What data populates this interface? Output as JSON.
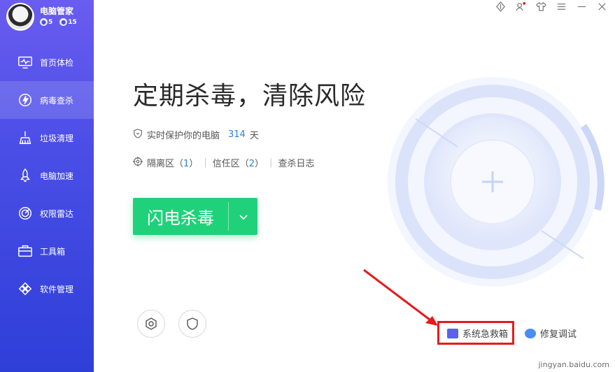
{
  "app": {
    "name": "电脑管家",
    "badges": [
      "5",
      "15"
    ]
  },
  "sidebar": {
    "items": [
      {
        "label": "首页体检",
        "icon": "monitor-pulse-icon"
      },
      {
        "label": "病毒查杀",
        "icon": "lightning-shield-icon",
        "active": true
      },
      {
        "label": "垃圾清理",
        "icon": "broom-icon"
      },
      {
        "label": "电脑加速",
        "icon": "rocket-icon"
      },
      {
        "label": "权限雷达",
        "icon": "radar-icon"
      },
      {
        "label": "工具箱",
        "icon": "toolbox-icon"
      },
      {
        "label": "软件管理",
        "icon": "apps-icon"
      }
    ]
  },
  "main": {
    "headline": "定期杀毒，清除风险",
    "protect_text": "实时保护你的电脑",
    "protect_days": "314",
    "protect_unit": "天",
    "quarantine_label": "隔离区",
    "quarantine_count": "1",
    "trusted_label": "信任区",
    "trusted_count": "2",
    "scan_log_label": "查杀日志",
    "scan_button": "闪电杀毒",
    "system_first_aid": "系统急救箱",
    "hardware_check": "修复调试"
  },
  "watermark": "jingyan.baidu.com",
  "colors": {
    "sidebar_top": "#6a5cf0",
    "sidebar_bottom": "#2e3fd8",
    "accent_green": "#1fd17a",
    "link_blue": "#2784d6",
    "highlight_red": "#e51c1c"
  }
}
